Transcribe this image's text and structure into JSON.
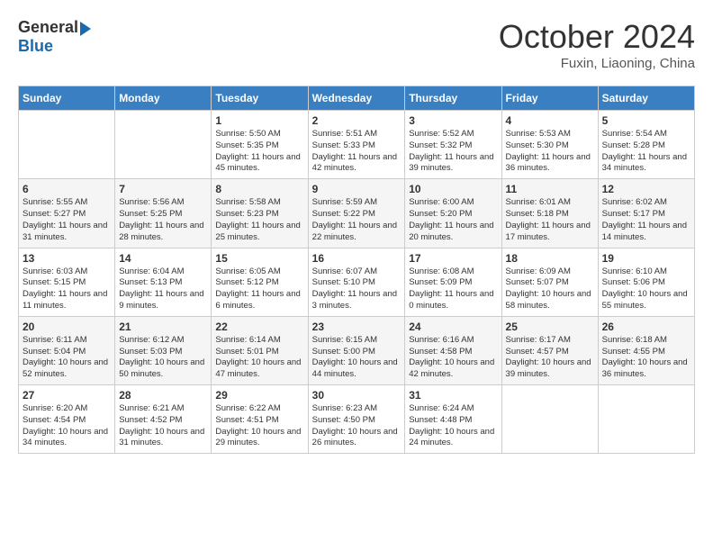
{
  "header": {
    "logo_general": "General",
    "logo_blue": "Blue",
    "month": "October 2024",
    "location": "Fuxin, Liaoning, China"
  },
  "days_of_week": [
    "Sunday",
    "Monday",
    "Tuesday",
    "Wednesday",
    "Thursday",
    "Friday",
    "Saturday"
  ],
  "weeks": [
    [
      {
        "num": "",
        "info": ""
      },
      {
        "num": "",
        "info": ""
      },
      {
        "num": "1",
        "info": "Sunrise: 5:50 AM\nSunset: 5:35 PM\nDaylight: 11 hours and 45 minutes."
      },
      {
        "num": "2",
        "info": "Sunrise: 5:51 AM\nSunset: 5:33 PM\nDaylight: 11 hours and 42 minutes."
      },
      {
        "num": "3",
        "info": "Sunrise: 5:52 AM\nSunset: 5:32 PM\nDaylight: 11 hours and 39 minutes."
      },
      {
        "num": "4",
        "info": "Sunrise: 5:53 AM\nSunset: 5:30 PM\nDaylight: 11 hours and 36 minutes."
      },
      {
        "num": "5",
        "info": "Sunrise: 5:54 AM\nSunset: 5:28 PM\nDaylight: 11 hours and 34 minutes."
      }
    ],
    [
      {
        "num": "6",
        "info": "Sunrise: 5:55 AM\nSunset: 5:27 PM\nDaylight: 11 hours and 31 minutes."
      },
      {
        "num": "7",
        "info": "Sunrise: 5:56 AM\nSunset: 5:25 PM\nDaylight: 11 hours and 28 minutes."
      },
      {
        "num": "8",
        "info": "Sunrise: 5:58 AM\nSunset: 5:23 PM\nDaylight: 11 hours and 25 minutes."
      },
      {
        "num": "9",
        "info": "Sunrise: 5:59 AM\nSunset: 5:22 PM\nDaylight: 11 hours and 22 minutes."
      },
      {
        "num": "10",
        "info": "Sunrise: 6:00 AM\nSunset: 5:20 PM\nDaylight: 11 hours and 20 minutes."
      },
      {
        "num": "11",
        "info": "Sunrise: 6:01 AM\nSunset: 5:18 PM\nDaylight: 11 hours and 17 minutes."
      },
      {
        "num": "12",
        "info": "Sunrise: 6:02 AM\nSunset: 5:17 PM\nDaylight: 11 hours and 14 minutes."
      }
    ],
    [
      {
        "num": "13",
        "info": "Sunrise: 6:03 AM\nSunset: 5:15 PM\nDaylight: 11 hours and 11 minutes."
      },
      {
        "num": "14",
        "info": "Sunrise: 6:04 AM\nSunset: 5:13 PM\nDaylight: 11 hours and 9 minutes."
      },
      {
        "num": "15",
        "info": "Sunrise: 6:05 AM\nSunset: 5:12 PM\nDaylight: 11 hours and 6 minutes."
      },
      {
        "num": "16",
        "info": "Sunrise: 6:07 AM\nSunset: 5:10 PM\nDaylight: 11 hours and 3 minutes."
      },
      {
        "num": "17",
        "info": "Sunrise: 6:08 AM\nSunset: 5:09 PM\nDaylight: 11 hours and 0 minutes."
      },
      {
        "num": "18",
        "info": "Sunrise: 6:09 AM\nSunset: 5:07 PM\nDaylight: 10 hours and 58 minutes."
      },
      {
        "num": "19",
        "info": "Sunrise: 6:10 AM\nSunset: 5:06 PM\nDaylight: 10 hours and 55 minutes."
      }
    ],
    [
      {
        "num": "20",
        "info": "Sunrise: 6:11 AM\nSunset: 5:04 PM\nDaylight: 10 hours and 52 minutes."
      },
      {
        "num": "21",
        "info": "Sunrise: 6:12 AM\nSunset: 5:03 PM\nDaylight: 10 hours and 50 minutes."
      },
      {
        "num": "22",
        "info": "Sunrise: 6:14 AM\nSunset: 5:01 PM\nDaylight: 10 hours and 47 minutes."
      },
      {
        "num": "23",
        "info": "Sunrise: 6:15 AM\nSunset: 5:00 PM\nDaylight: 10 hours and 44 minutes."
      },
      {
        "num": "24",
        "info": "Sunrise: 6:16 AM\nSunset: 4:58 PM\nDaylight: 10 hours and 42 minutes."
      },
      {
        "num": "25",
        "info": "Sunrise: 6:17 AM\nSunset: 4:57 PM\nDaylight: 10 hours and 39 minutes."
      },
      {
        "num": "26",
        "info": "Sunrise: 6:18 AM\nSunset: 4:55 PM\nDaylight: 10 hours and 36 minutes."
      }
    ],
    [
      {
        "num": "27",
        "info": "Sunrise: 6:20 AM\nSunset: 4:54 PM\nDaylight: 10 hours and 34 minutes."
      },
      {
        "num": "28",
        "info": "Sunrise: 6:21 AM\nSunset: 4:52 PM\nDaylight: 10 hours and 31 minutes."
      },
      {
        "num": "29",
        "info": "Sunrise: 6:22 AM\nSunset: 4:51 PM\nDaylight: 10 hours and 29 minutes."
      },
      {
        "num": "30",
        "info": "Sunrise: 6:23 AM\nSunset: 4:50 PM\nDaylight: 10 hours and 26 minutes."
      },
      {
        "num": "31",
        "info": "Sunrise: 6:24 AM\nSunset: 4:48 PM\nDaylight: 10 hours and 24 minutes."
      },
      {
        "num": "",
        "info": ""
      },
      {
        "num": "",
        "info": ""
      }
    ]
  ]
}
